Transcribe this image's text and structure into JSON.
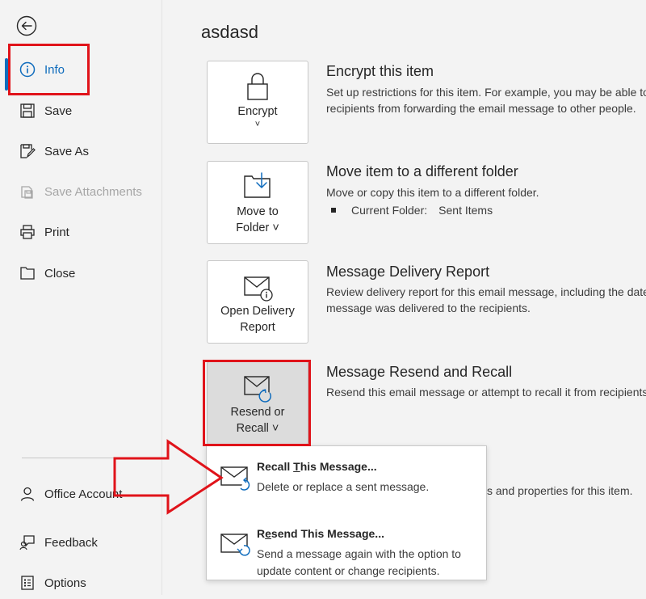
{
  "sidebar": {
    "back": "back-arrow",
    "items": [
      {
        "label": "Info",
        "icon": "info-icon",
        "state": "active"
      },
      {
        "label": "Save",
        "icon": "save-icon"
      },
      {
        "label": "Save As",
        "icon": "save-as-icon"
      },
      {
        "label": "Save Attachments",
        "icon": "save-attachments-icon",
        "state": "disabled"
      },
      {
        "label": "Print",
        "icon": "print-icon"
      },
      {
        "label": "Close",
        "icon": "close-folder-icon"
      }
    ],
    "bottom_items": [
      {
        "label": "Office Account",
        "icon": "person-icon"
      },
      {
        "label": "Feedback",
        "icon": "feedback-icon"
      },
      {
        "label": "Options",
        "icon": "options-icon"
      }
    ]
  },
  "main": {
    "title": "asdasd",
    "sections": [
      {
        "button_label_1": "Encrypt",
        "button_label_2": "˅",
        "title": "Encrypt this item",
        "desc_1": "Set up restrictions for this item. For example, you may be able to prevent",
        "desc_2": "recipients from forwarding the email message to other people."
      },
      {
        "button_label_1": "Move to",
        "button_label_2": "Folder ˅",
        "title": "Move item to a different folder",
        "desc_1": "Move or copy this item to a different folder.",
        "folder_label": "Current Folder:",
        "folder_value": "Sent Items"
      },
      {
        "button_label_1": "Open Delivery",
        "button_label_2": "Report",
        "title": "Message Delivery Report",
        "desc_1": "Review delivery report for this email message, including the date and time the",
        "desc_2": "message was delivered to the recipients."
      },
      {
        "button_label_1": "Resend or",
        "button_label_2": "Recall ˅",
        "title": "Message Resend and Recall",
        "desc_1": "Resend this email message or attempt to recall it from recipients."
      }
    ],
    "partial_text": "s and properties for this item."
  },
  "dropdown": {
    "items": [
      {
        "title_pre": "Recall ",
        "title_ul": "T",
        "title_post": "his Message...",
        "desc": "Delete or replace a sent message."
      },
      {
        "title_pre": "R",
        "title_ul": "e",
        "title_post": "send This Message...",
        "desc": "Send a message again with the option to update content or change recipients."
      }
    ]
  },
  "colors": {
    "accent": "#0f6cbd",
    "annotation": "#e0131a",
    "background": "#f3f3f3"
  }
}
